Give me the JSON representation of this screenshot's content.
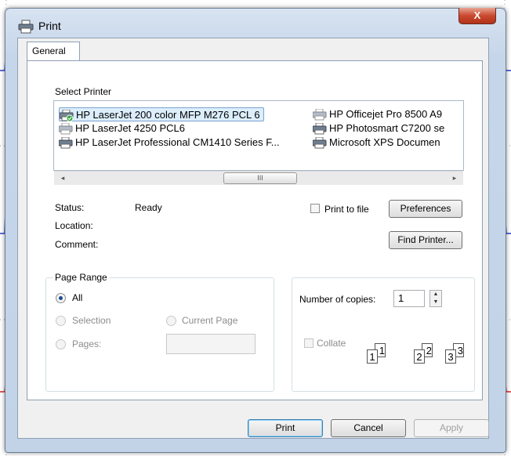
{
  "window": {
    "title": "Print",
    "close_glyph": "X"
  },
  "tabs": [
    {
      "label": "General"
    }
  ],
  "select_printer": {
    "group_label": "Select Printer",
    "printers": [
      {
        "name": "HP LaserJet 200 color MFP M276 PCL 6",
        "selected": true,
        "default": true
      },
      {
        "name": "HP LaserJet 4250 PCL6"
      },
      {
        "name": "HP LaserJet Professional CM1410 Series F..."
      },
      {
        "name": "HP Officejet Pro 8500 A9"
      },
      {
        "name": "HP Photosmart C7200 se"
      },
      {
        "name": "Microsoft XPS Documen"
      }
    ],
    "scroll_left_glyph": "◂",
    "scroll_right_glyph": "▸",
    "scroll_thumb_glyph": "III"
  },
  "status": {
    "status_label": "Status:",
    "status_value": "Ready",
    "location_label": "Location:",
    "location_value": "",
    "comment_label": "Comment:",
    "comment_value": ""
  },
  "print_to_file_label": "Print to file",
  "preferences_label": "Preferences",
  "find_printer_label": "Find Printer...",
  "page_range": {
    "group_label": "Page Range",
    "all_label": "All",
    "selection_label": "Selection",
    "current_page_label": "Current Page",
    "pages_label": "Pages:",
    "pages_value": "",
    "selected_option": "All"
  },
  "copies": {
    "label": "Number of copies:",
    "value": "1",
    "collate_label": "Collate",
    "collate_page_numbers": [
      "1",
      "1",
      "2",
      "2",
      "3",
      "3"
    ]
  },
  "buttons": {
    "print": "Print",
    "cancel": "Cancel",
    "apply": "Apply"
  },
  "colors": {
    "selection": "#dceefc",
    "close_button": "#c9492f",
    "frame": "#c6d6ea"
  }
}
